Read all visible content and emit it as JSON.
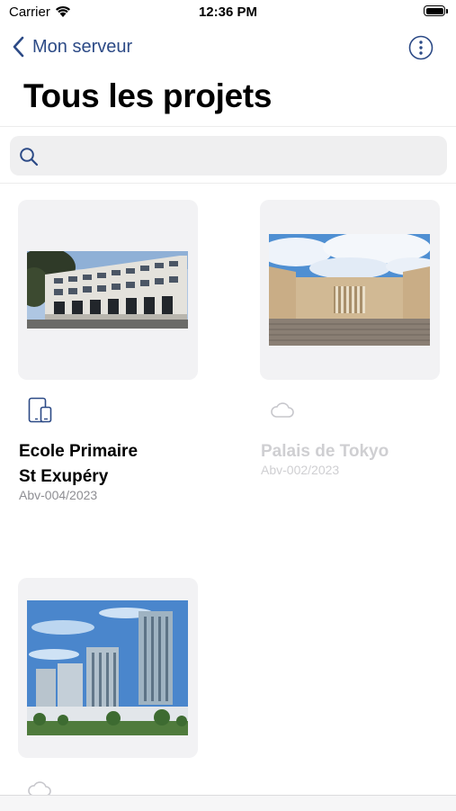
{
  "status_bar": {
    "carrier": "Carrier",
    "time": "12:36 PM"
  },
  "nav": {
    "back_label": "Mon serveur",
    "title": "Tous les projets"
  },
  "search": {
    "placeholder": "",
    "value": ""
  },
  "projects": [
    {
      "name": "Ecole Primaire",
      "name_line2": "St Exupéry",
      "ref": "Abv-004/2023",
      "status_icon": "device-icon"
    },
    {
      "name": "Palais de Tokyo",
      "ref": "Abv-002/2023",
      "status_icon": "cloud-icon"
    },
    {
      "status_icon": "cloud-icon"
    }
  ],
  "colors": {
    "accent": "#2c4a86",
    "card_bg": "#f2f2f4",
    "secondary_text": "#8e8e93",
    "dim_text": "#cfcfd2"
  }
}
